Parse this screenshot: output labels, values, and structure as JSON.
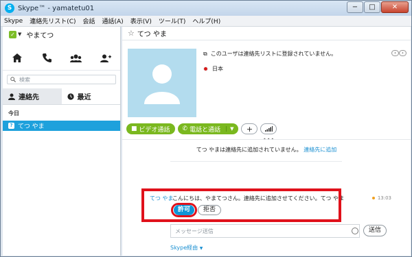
{
  "window": {
    "title": "Skype™ - yamatetu01",
    "app_icon_glyph": "S",
    "controls": [
      "−",
      "□",
      "✕"
    ]
  },
  "menu": [
    "Skype",
    "連絡先リスト(C)",
    "会話",
    "通話(A)",
    "表示(V)",
    "ツール(T)",
    "ヘルプ(H)"
  ],
  "sidebar": {
    "profile_name": "やまてつ",
    "status_color": "#7cbd27",
    "nav_icons": [
      "home-icon",
      "phone-icon",
      "group-icon",
      "add-contact-icon"
    ],
    "search_placeholder": "検索",
    "tabs": [
      {
        "label": "連絡先",
        "icon": "person-icon",
        "active": true
      },
      {
        "label": "最近",
        "icon": "clock-icon",
        "active": false
      }
    ],
    "section": "今日",
    "contacts": [
      {
        "name": "てつ やま",
        "selected": true
      }
    ]
  },
  "conversation": {
    "contact_name": "てつ やま",
    "not_in_list_notice": "このユーザは連絡先リストに登録されていません。",
    "country": "日本",
    "video_call": "ビデオ通話",
    "call_phone": "電話と通話",
    "banner_text": "てつ やまは連絡先に追加されていません。",
    "banner_link": "連絡先に追加",
    "message": {
      "sender": "てつ やま",
      "text": "こんにちは、やまてつさん。連絡先に追加させてください。てつ やま",
      "time": "13:03",
      "accept": "許可",
      "reject": "拒否"
    },
    "compose_placeholder": "メッセージ送信",
    "send_label": "送信",
    "via_label": "Skype経由"
  },
  "colors": {
    "accent_blue": "#0e95d7",
    "selection_blue": "#1ea1dc",
    "green": "#7ab81f",
    "highlight_red": "#e0111b"
  }
}
